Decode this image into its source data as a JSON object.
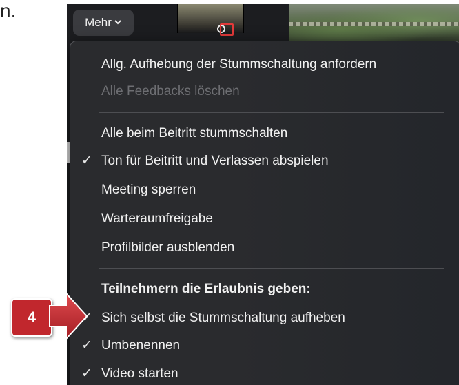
{
  "caption_fragment": "n.",
  "toolbar": {
    "more_label": "Mehr",
    "more_icon": "chevron-down-icon"
  },
  "menu": {
    "items": [
      {
        "label": "Allg. Aufhebung der Stummschaltung anfordern",
        "checked": false,
        "enabled": true
      },
      {
        "label": "Alle Feedbacks löschen",
        "checked": false,
        "enabled": false
      },
      {
        "label": "Alle beim Beitritt stummschalten",
        "checked": false,
        "enabled": true
      },
      {
        "label": "Ton für Beitritt und Verlassen abspielen",
        "checked": true,
        "enabled": true
      },
      {
        "label": "Meeting sperren",
        "checked": false,
        "enabled": true
      },
      {
        "label": "Warteraumfreigabe",
        "checked": false,
        "enabled": true
      },
      {
        "label": "Profilbilder ausblenden",
        "checked": false,
        "enabled": true
      }
    ],
    "section_header": "Teilnehmern die Erlaubnis geben:",
    "permissions": [
      {
        "label": "Sich selbst die Stummschaltung aufheben",
        "checked": true
      },
      {
        "label": "Umbenennen",
        "checked": true
      },
      {
        "label": "Video starten",
        "checked": true
      }
    ],
    "check_glyph": "✓"
  },
  "callout": {
    "number": "4",
    "color": "#c1272d"
  },
  "colors": {
    "menu_bg": "#2a2b2e",
    "accent_red": "#c1272d",
    "text": "#f1f1f1",
    "disabled_text": "#6d6e72"
  }
}
